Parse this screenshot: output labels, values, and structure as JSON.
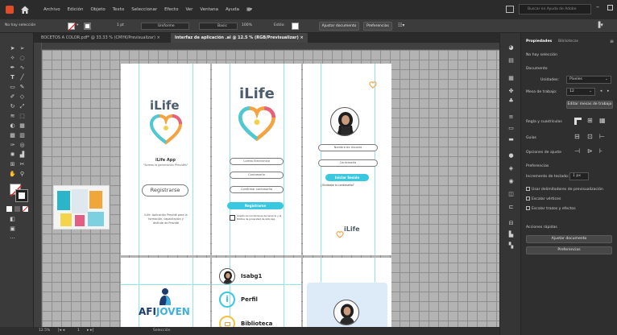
{
  "menubar": {
    "items": [
      "Archivo",
      "Edición",
      "Objeto",
      "Texto",
      "Seleccionar",
      "Efecto",
      "Ver",
      "Ventana",
      "Ayuda"
    ],
    "search_placeholder": "Buscar en Ayuda de Adobe"
  },
  "control_bar": {
    "selection_label": "No hay selección",
    "stroke_weight": "1 pt",
    "stroke_style": "Uniforme",
    "brush_label": "Basic",
    "opacity": "100%",
    "style_label": "Estilo:",
    "document_setup_button": "Ajustar documento",
    "preferences_button": "Preferencias"
  },
  "document_tabs": [
    {
      "label": "BOCETOS A COLOR.pdf* @ 33.33 % (CMYK/Previsualizar)",
      "active": false
    },
    {
      "label": "Interfaz de aplicación .ai @ 12.5 % (RGB/Previsualizar)",
      "active": true
    }
  ],
  "artboards": {
    "welcome": {
      "logo": "iLife",
      "app_name": "iLife App",
      "slogan": "\"Somos la generación Previdés\"",
      "register_button": "Registrarse",
      "footer_text": "iLife: Aplicación Previdé para la formación, capacitación y disfrute de Previdé"
    },
    "register": {
      "logo": "iLife",
      "email_placeholder": "Correo Electrónico",
      "password_placeholder": "Contraseña",
      "confirm_password_placeholder": "Confirmar contraseña",
      "submit_button": "Registrarse",
      "terms_text": "Acepto los Condiciones del servicio y la Política de privacidad de iLife App"
    },
    "login": {
      "username_placeholder": "Nombre de Usuario",
      "password_placeholder": "Contraseña",
      "login_button": "Iniciar Sesión",
      "forgot_password": "¿Olvidaste tu contraseña?",
      "logo": "iLife"
    },
    "brand": {
      "logo_text_dark": "AFI",
      "logo_text_accent": "JOVEN"
    },
    "menu": {
      "items": [
        {
          "label": "Isabg1",
          "icon": "avatar-icon"
        },
        {
          "label": "Perfil",
          "icon": "info-icon"
        },
        {
          "label": "Biblioteca",
          "icon": "book-icon"
        }
      ]
    }
  },
  "status_bar": {
    "zoom": "12.5%",
    "artboard_number": "1",
    "tool_name": "Selección"
  },
  "properties_panel": {
    "tabs": [
      "Propiedades",
      "Bibliotecas"
    ],
    "no_selection": "No hay selección",
    "document_heading": "Documento",
    "units_label": "Unidades:",
    "units_value": "Píxeles",
    "artboard_label": "Mesa de trabajo:",
    "artboard_value": "12",
    "edit_artboards_button": "Editar mesas de trabajo",
    "rulers_grids_label": "Regla y cuadrículas",
    "guides_label": "Guías",
    "snap_label": "Opciones de ajuste",
    "preferences_heading": "Preferencias",
    "keyboard_increment_label": "Incremento de teclado:",
    "keyboard_increment_value": "1 px",
    "checkboxes": [
      "Usar delimitadores de previsualización",
      "Escalar vértices",
      "Escalar trazos y efectos"
    ],
    "quick_actions_heading": "Acciones rápidas",
    "document_setup_button": "Ajustar documento",
    "preferences_button": "Preferencias"
  },
  "colors": {
    "teal": "#39c8e0",
    "logo_text": "#4d5d6b",
    "heart_orange": "#f4a340",
    "heart_pink": "#e9607a",
    "heart_teal": "#4ec9d4",
    "heart_yellow": "#f2d24a",
    "app_icon_bg": "#e34c26"
  }
}
